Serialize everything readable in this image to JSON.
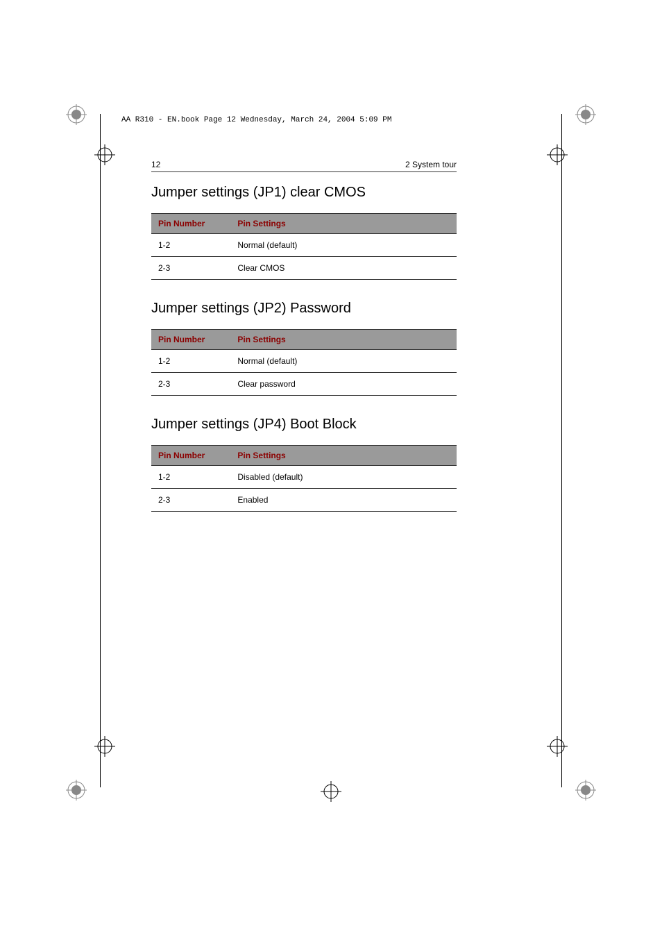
{
  "doc_header": "AA R310 - EN.book  Page 12  Wednesday, March 24, 2004  5:09 PM",
  "page_header": {
    "page_number": "12",
    "section": "2 System tour"
  },
  "sections": [
    {
      "title": "Jumper settings (JP1) clear CMOS",
      "col_headers": [
        "Pin Number",
        "Pin Settings"
      ],
      "rows": [
        [
          "1-2",
          "Normal (default)"
        ],
        [
          "2-3",
          "Clear CMOS"
        ]
      ]
    },
    {
      "title": "Jumper settings (JP2) Password",
      "col_headers": [
        "Pin Number",
        "Pin Settings"
      ],
      "rows": [
        [
          "1-2",
          "Normal (default)"
        ],
        [
          "2-3",
          "Clear password"
        ]
      ]
    },
    {
      "title": "Jumper settings (JP4) Boot Block",
      "col_headers": [
        "Pin Number",
        "Pin Settings"
      ],
      "rows": [
        [
          "1-2",
          "Disabled (default)"
        ],
        [
          "2-3",
          "Enabled"
        ]
      ]
    }
  ]
}
